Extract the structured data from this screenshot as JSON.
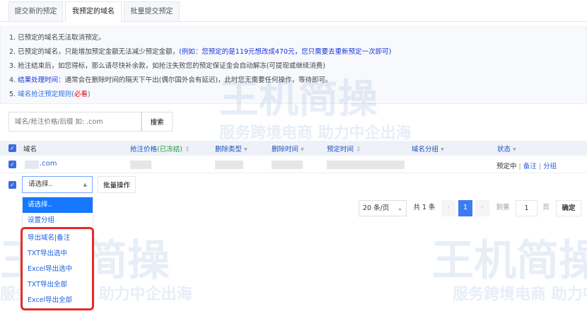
{
  "tabs": [
    {
      "label": "提交新的预定"
    },
    {
      "label": "我预定的域名"
    },
    {
      "label": "批量提交预定"
    }
  ],
  "notice": {
    "l1": "1. 已预定的域名无法取消预定。",
    "l2a": "2. 已预定的域名，只能增加预定金额无法减少预定金额，",
    "l2b": "(例如：您预定的是119元想改成470元，您只需要去重新预定一次即可)",
    "l3": "3. 抢注结束后，如您得标，那么请尽快补余款，如抢注失败您的预定保证金会自动解冻(可提现或继续消费)",
    "l4n": "4. ",
    "l4a": "结果处理时间：",
    "l4b": "通常会在删除时间的隔天下午出(偶尔国外会有延迟)，此时您无需要任何操作，等待即可。",
    "l5n": "5. ",
    "l5a": "域名抢注预定规则(",
    "l5b": "必看",
    "l5c": ")"
  },
  "watermark": {
    "brand": "王机简操",
    "slogan": "服务跨境电商 助力中企出海"
  },
  "search": {
    "placeholder": "域名/抢注价格/后缀 如: .com",
    "button": "搜索"
  },
  "table": {
    "headers": {
      "domain": "域名",
      "price": "抢注价格",
      "frozen": "(已冻结)",
      "delete_type": "删除类型",
      "delete_time": "删除时间",
      "reserve_time": "预定时间",
      "group": "域名分组",
      "status": "状态"
    },
    "rows": [
      {
        "domain": ".com",
        "status": "预定中",
        "note": "备注",
        "group": "分组"
      }
    ]
  },
  "bulk": {
    "select_value": "请选择..",
    "button": "批量操作",
    "options": [
      "请选择..",
      "设置分组",
      "导出域名|备注",
      "TXT导出选中",
      "Excel导出选中",
      "TXT导出全部",
      "Excel导出全部"
    ]
  },
  "pagination": {
    "page_size": "20 条/页",
    "total": "共 1 条",
    "current": "1",
    "goto_label": "到第",
    "goto_value": "1",
    "page_unit": "页",
    "confirm": "确定"
  }
}
